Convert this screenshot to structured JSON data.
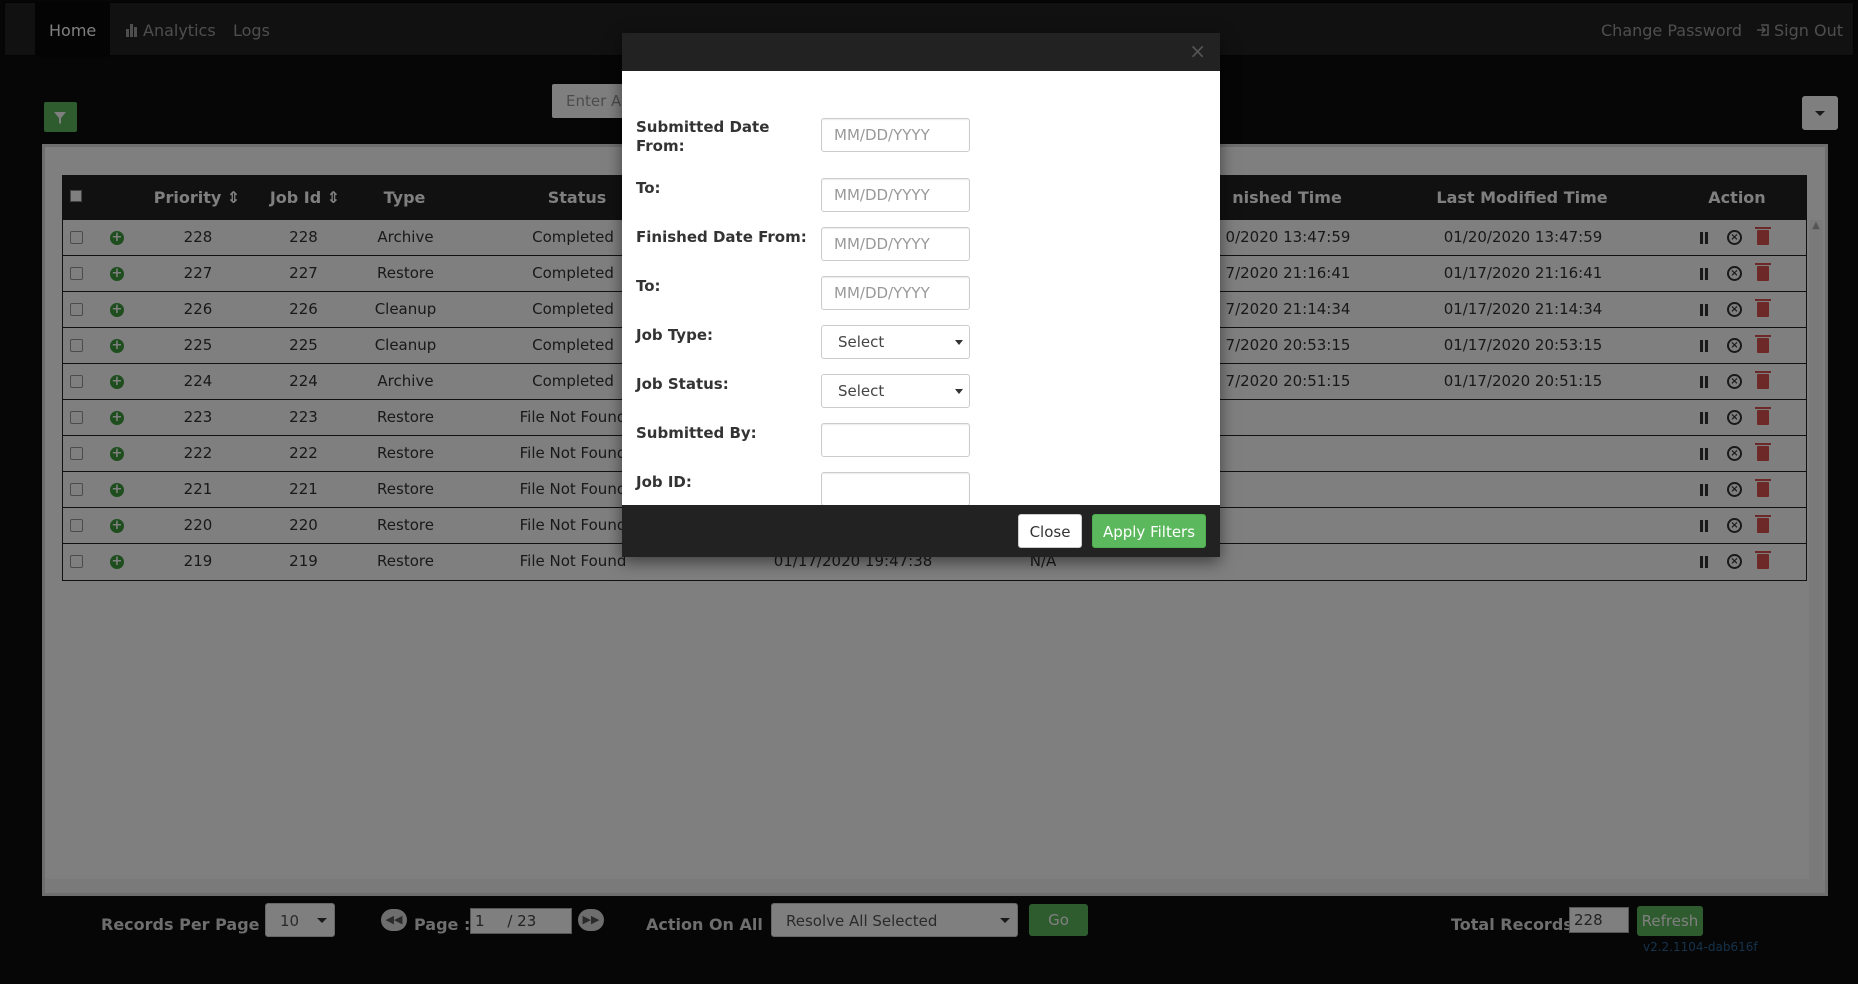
{
  "nav": {
    "home": "Home",
    "analytics": "Analytics",
    "logs": "Logs",
    "change_password": "Change Password",
    "sign_out": "Sign Out"
  },
  "search": {
    "placeholder_partial": "Enter As"
  },
  "table": {
    "headers": {
      "priority": "Priority",
      "job_id": "Job Id",
      "type": "Type",
      "status": "Status",
      "finished_time_partial": "nished Time",
      "last_modified": "Last Modified Time",
      "action": "Action"
    },
    "rows": [
      {
        "priority": "228",
        "job_id": "228",
        "type": "Archive",
        "status": "Completed",
        "finished": "0/2020 13:47:59",
        "modified": "01/20/2020 13:47:59"
      },
      {
        "priority": "227",
        "job_id": "227",
        "type": "Restore",
        "status": "Completed",
        "finished": "7/2020 21:16:41",
        "modified": "01/17/2020 21:16:41"
      },
      {
        "priority": "226",
        "job_id": "226",
        "type": "Cleanup",
        "status": "Completed",
        "finished": "7/2020 21:14:34",
        "modified": "01/17/2020 21:14:34"
      },
      {
        "priority": "225",
        "job_id": "225",
        "type": "Cleanup",
        "status": "Completed",
        "finished": "7/2020 20:53:15",
        "modified": "01/17/2020 20:53:15"
      },
      {
        "priority": "224",
        "job_id": "224",
        "type": "Archive",
        "status": "Completed",
        "finished": "7/2020 20:51:15",
        "modified": "01/17/2020 20:51:15"
      },
      {
        "priority": "223",
        "job_id": "223",
        "type": "Restore",
        "status": "File Not Found",
        "finished": "",
        "modified": ""
      },
      {
        "priority": "222",
        "job_id": "222",
        "type": "Restore",
        "status": "File Not Found",
        "finished": "",
        "modified": ""
      },
      {
        "priority": "221",
        "job_id": "221",
        "type": "Restore",
        "status": "File Not Found",
        "finished": "",
        "modified": ""
      },
      {
        "priority": "220",
        "job_id": "220",
        "type": "Restore",
        "status": "File Not Found",
        "finished": "",
        "modified": ""
      },
      {
        "priority": "219",
        "job_id": "219",
        "type": "Restore",
        "status": "File Not Found",
        "finished": "",
        "modified": ""
      }
    ],
    "partial_last_row": {
      "submitted": "01/17/2020 19:47:38",
      "started": "N/A"
    }
  },
  "footer": {
    "records_per_page_label": "Records Per Page :",
    "records_per_page_value": "10",
    "page_label": "Page :",
    "page_value": "1",
    "page_total": "/  23",
    "action_on_all_label": "Action On All",
    "action_value": "Resolve All Selected",
    "go": "Go",
    "total_records_label": "Total Records:",
    "total_records_value": "228",
    "refresh": "Refresh",
    "version": "v2.2.1104-dab616f"
  },
  "modal": {
    "close_x": "×",
    "fields": {
      "submitted_from_label": "Submitted Date From:",
      "submitted_from_placeholder": "MM/DD/YYYY",
      "submitted_to_label": "To:",
      "submitted_to_placeholder": "MM/DD/YYYY",
      "finished_from_label": "Finished Date From:",
      "finished_from_placeholder": "MM/DD/YYYY",
      "finished_to_label": "To:",
      "finished_to_placeholder": "MM/DD/YYYY",
      "job_type_label": "Job Type:",
      "job_type_value": "Select",
      "job_status_label": "Job Status:",
      "job_status_value": "Select",
      "submitted_by_label": "Submitted By:",
      "submitted_by_value": "",
      "job_id_label": "Job ID:",
      "job_id_value": ""
    },
    "close_button": "Close",
    "apply_button": "Apply Filters"
  },
  "colors": {
    "accent_green": "#5cb85c",
    "danger_red": "#d9534f",
    "navbar": "#222222"
  }
}
